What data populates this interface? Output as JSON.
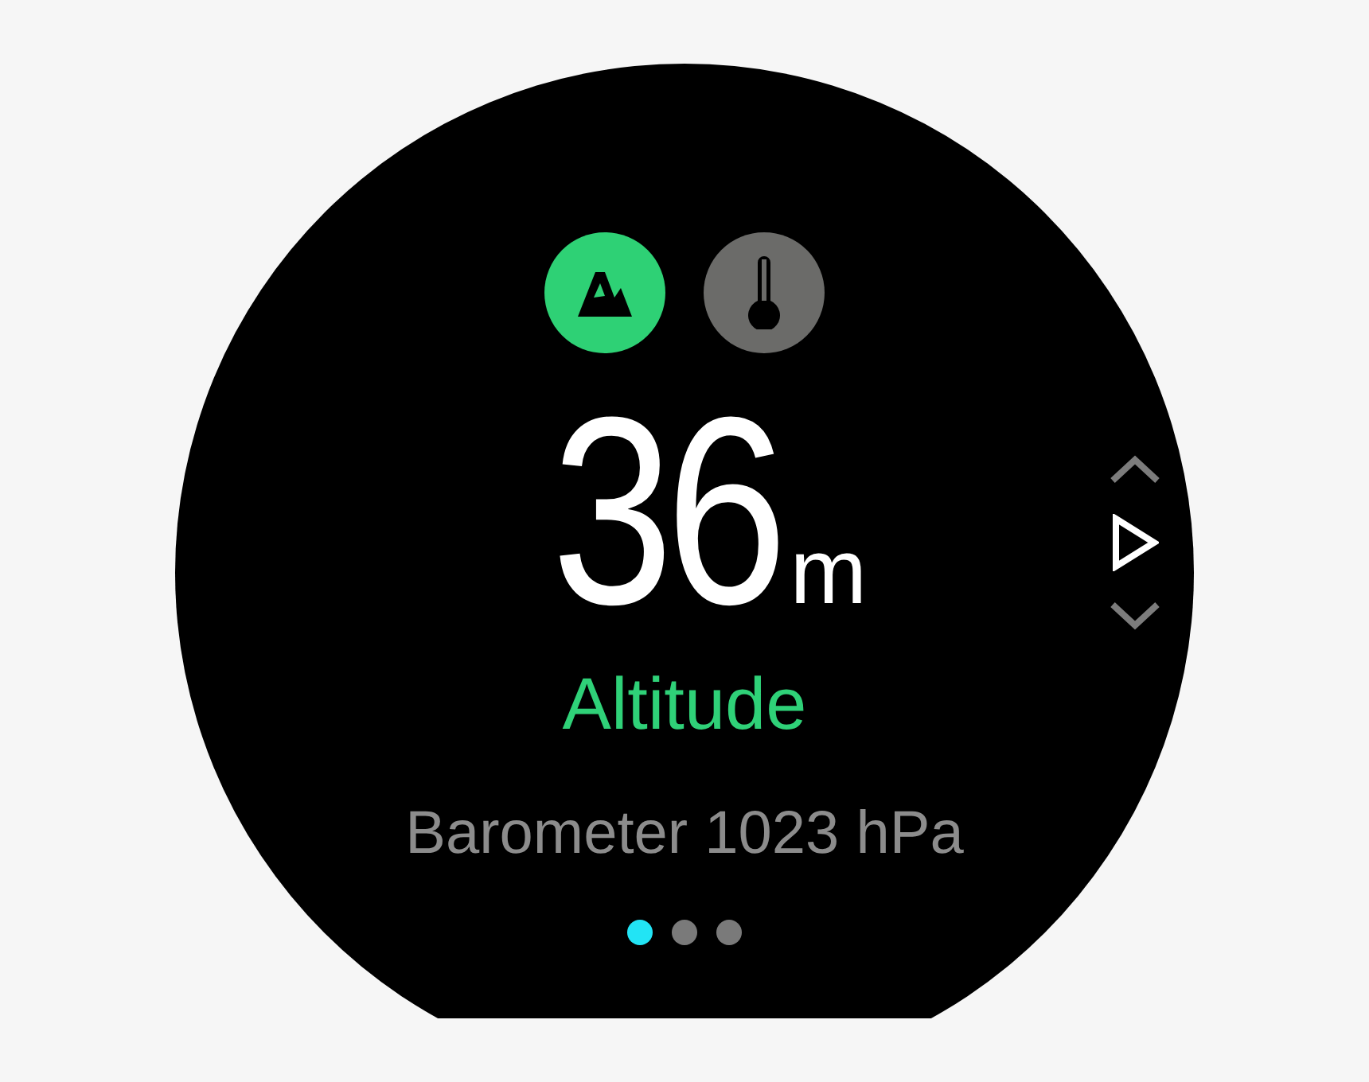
{
  "modes": [
    {
      "kind": "mountain",
      "selected": true
    },
    {
      "kind": "thermometer",
      "selected": false
    }
  ],
  "reading": {
    "value": "36",
    "unit": "m",
    "label": "Altitude"
  },
  "secondary": "Barometer 1023 hPa",
  "side_controls": [
    {
      "kind": "up"
    },
    {
      "kind": "play"
    },
    {
      "kind": "down"
    }
  ],
  "pages": [
    {
      "selected": true
    },
    {
      "selected": false
    },
    {
      "selected": false
    }
  ]
}
